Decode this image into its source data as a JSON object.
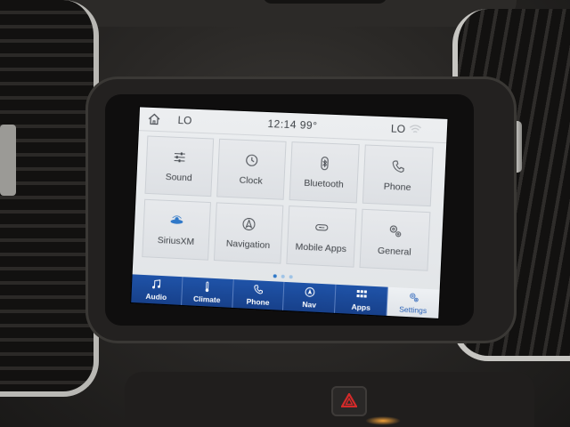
{
  "status": {
    "left_temp": "LO",
    "time_temp": "12:14  99°",
    "right_temp": "LO"
  },
  "tiles": [
    {
      "label": "Sound",
      "icon": "equalizer-icon"
    },
    {
      "label": "Clock",
      "icon": "clock-icon"
    },
    {
      "label": "Bluetooth",
      "icon": "bluetooth-icon"
    },
    {
      "label": "Phone",
      "icon": "phone-icon"
    },
    {
      "label": "SiriusXM",
      "icon": "siriusxm-icon"
    },
    {
      "label": "Navigation",
      "icon": "navigation-icon"
    },
    {
      "label": "Mobile Apps",
      "icon": "mobile-apps-icon"
    },
    {
      "label": "General",
      "icon": "gears-icon"
    }
  ],
  "page_indicator": {
    "pages": 3,
    "current": 1
  },
  "navbar": [
    {
      "label": "Audio",
      "icon": "music-note-icon"
    },
    {
      "label": "Climate",
      "icon": "thermometer-icon"
    },
    {
      "label": "Phone",
      "icon": "phone-icon"
    },
    {
      "label": "Nav",
      "icon": "compass-icon"
    },
    {
      "label": "Apps",
      "icon": "apps-grid-icon"
    },
    {
      "label": "Settings",
      "icon": "gears-icon",
      "active": true
    }
  ],
  "colors": {
    "navbar": "#1f53a8",
    "accent": "#2f78c8",
    "hazard": "#d42a2a"
  }
}
